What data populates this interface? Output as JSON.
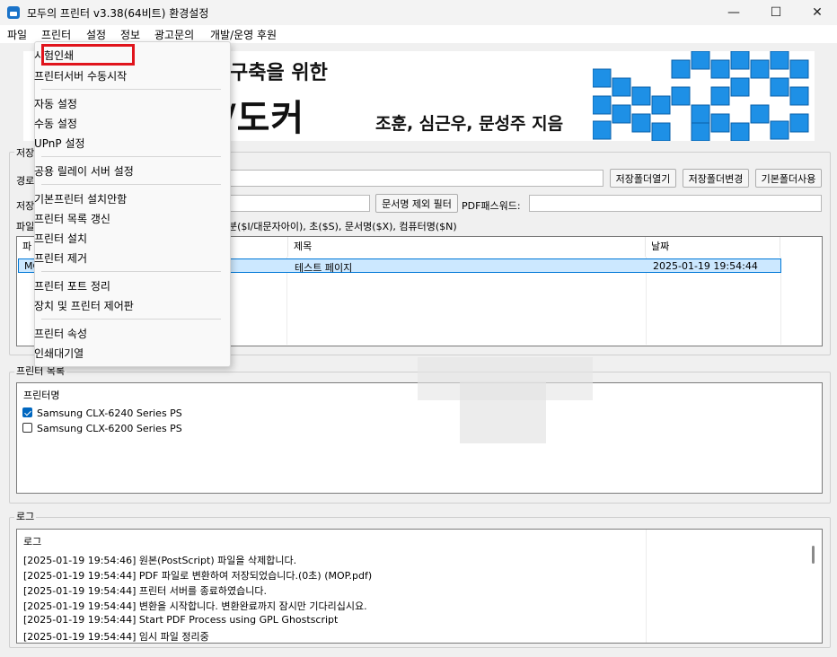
{
  "window": {
    "title": "모두의 프린터 v3.38(64비트) 환경설정",
    "minimize": "—",
    "maximize": "☐",
    "close": "✕"
  },
  "menubar": [
    "파일",
    "프린터",
    "설정",
    "정보",
    "광고문의",
    "개발/운영 후원"
  ],
  "banner": {
    "headline": "구축을 위한",
    "subtitle": "/도커",
    "authors": "조훈, 심근우, 문성주 지음"
  },
  "save_group": {
    "label": "저장",
    "path_label": "경로",
    "btn_open": "저장폴더열기",
    "btn_change": "저장폴더변경",
    "btn_default": "기본폴더사용",
    "save_label": "저장",
    "btn_filter": "문서명 제외 필터",
    "pdf_password_label": "PDF패스워드:",
    "filename_label": "파일",
    "filename_hint": "초($S), 문서명($X), 컴퓨터명($N)",
    "filename_hint_full": "분($I/대문자아이), 초($S), 문서명($X), 컴퓨터명($N)"
  },
  "file_list": {
    "col_file": "파",
    "col_title": "제목",
    "col_date": "날짜",
    "rows": [
      {
        "file": "MO",
        "title": "테스트 페이지",
        "date": "2025-01-19 19:54:44"
      }
    ]
  },
  "printer_group": {
    "label": "프린터 목록",
    "col_name": "프린터명",
    "printers": [
      {
        "name": "Samsung CLX-6240 Series PS",
        "checked": true
      },
      {
        "name": "Samsung CLX-6200 Series PS",
        "checked": false
      }
    ]
  },
  "log_group": {
    "label": "로그",
    "col": "로그",
    "lines": [
      "[2025-01-19 19:54:46] 원본(PostScript) 파일을 삭제합니다.",
      "[2025-01-19 19:54:44] PDF 파일로 변환하여 저장되었습니다.(0초) (MOP.pdf)",
      "[2025-01-19 19:54:44] 프린터 서버를 종료하였습니다.",
      "[2025-01-19 19:54:44] 변환을 시작합니다. 변환완료까지 잠시만 기다리십시요.",
      "[2025-01-19 19:54:44] Start PDF Process using GPL Ghostscript",
      "[2025-01-19 19:54:44] 임시 파일 정리중"
    ]
  },
  "dropdown": {
    "items": [
      "시험인쇄",
      "프린터서버 수동시작",
      "자동 설정",
      "수동 설정",
      "UPnP 설정",
      "공용 릴레이 서버 설정",
      "기본프린터 설치안함",
      "프린터 목록 갱신",
      "프린터 설치",
      "프린터 제거",
      "프린터 포트 정리",
      "장치 및 프린터 제어판",
      "프린터 속성",
      "인쇄대기열"
    ]
  },
  "colors": {
    "accent": "#0067c0",
    "highlight": "#e0141c",
    "selected_row": "#cce8ff",
    "banner_cube": "#1e90e6"
  },
  "icons": [
    "printer-app-icon",
    "checkbox-checked-icon",
    "minimize-icon",
    "maximize-icon",
    "close-icon"
  ]
}
